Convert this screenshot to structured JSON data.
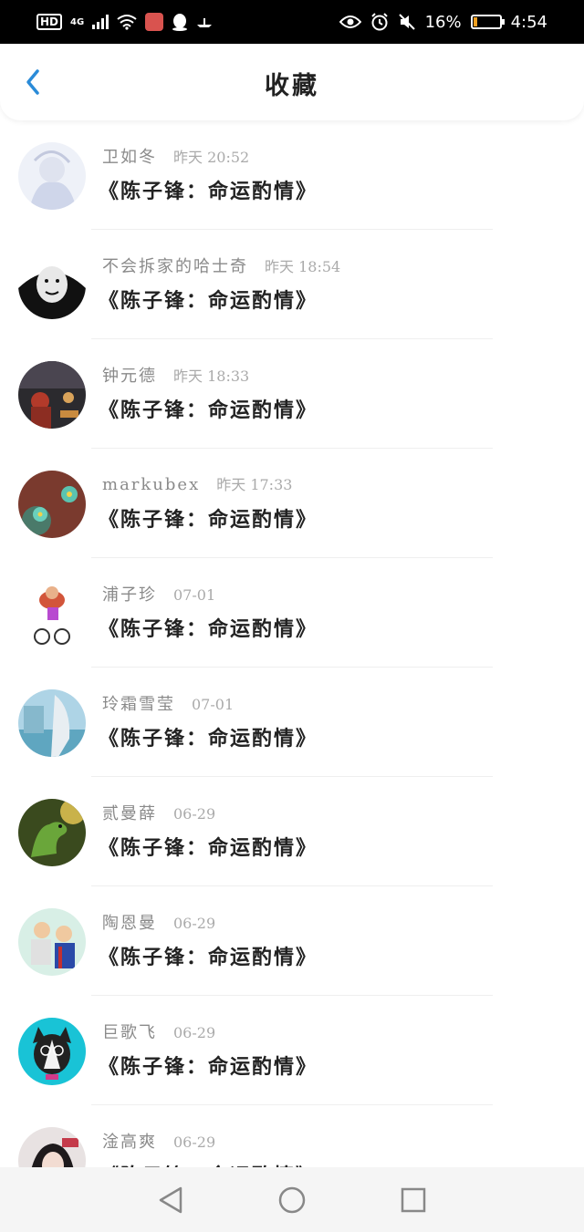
{
  "status_bar": {
    "network_badge": "HD",
    "network_type": "4G",
    "battery_percent": "16%",
    "time": "4:54",
    "battery_level": 0.16
  },
  "header": {
    "title": "收藏",
    "back_icon": "chevron-left-icon",
    "accent_color": "#2a8bd8"
  },
  "items": [
    {
      "name": "卫如冬",
      "time": "昨天 20:52",
      "title": "《陈子锋：命运酌情》",
      "avatar": "illustration-avatar"
    },
    {
      "name": "不会拆家的哈士奇",
      "time": "昨天 18:54",
      "title": "《陈子锋：命运酌情》",
      "avatar": "meme-avatar"
    },
    {
      "name": "钟元德",
      "time": "昨天 18:33",
      "title": "《陈子锋：命运酌情》",
      "avatar": "photo-avatar"
    },
    {
      "name": "markubex",
      "time": "昨天 17:33",
      "title": "《陈子锋：命运酌情》",
      "avatar": "flower-avatar"
    },
    {
      "name": "浦子珍",
      "time": "07-01",
      "title": "《陈子锋：命运酌情》",
      "avatar": "cyclist-avatar"
    },
    {
      "name": "玲霜雪莹",
      "time": "07-01",
      "title": "《陈子锋：命运酌情》",
      "avatar": "anime-avatar"
    },
    {
      "name": "贰曼薛",
      "time": "06-29",
      "title": "《陈子锋：命运酌情》",
      "avatar": "dinosaur-avatar"
    },
    {
      "name": "陶恩曼",
      "time": "06-29",
      "title": "《陈子锋：命运酌情》",
      "avatar": "cartoon-avatar"
    },
    {
      "name": "巨歌飞",
      "time": "06-29",
      "title": "《陈子锋：命运酌情》",
      "avatar": "husky-avatar"
    },
    {
      "name": "淦高爽",
      "time": "06-29",
      "title": "《陈子锋：命运酌情》",
      "avatar": "portrait-avatar"
    }
  ],
  "nav_bar": {
    "back": "triangle-back-icon",
    "home": "circle-home-icon",
    "recents": "square-recents-icon"
  }
}
